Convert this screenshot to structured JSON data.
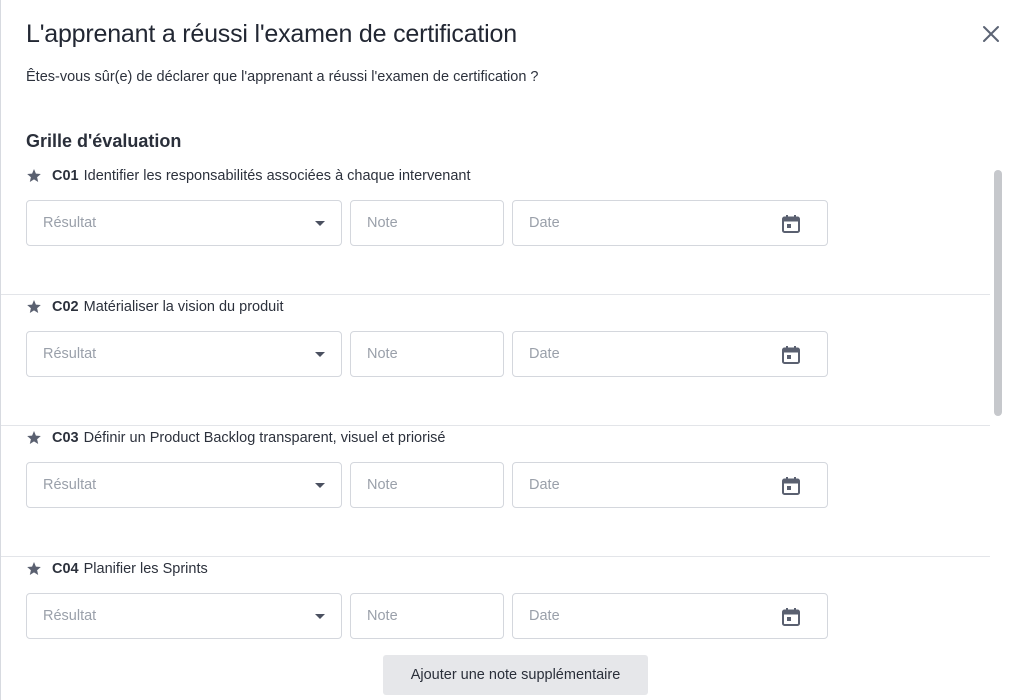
{
  "dialog": {
    "title": "L'apprenant a réussi l'examen de certification",
    "subtitle": "Êtes-vous sûr(e) de déclarer que l'apprenant a réussi l'examen de certification ?",
    "close_icon": "close-icon"
  },
  "grid": {
    "title": "Grille d'évaluation",
    "competencies": [
      {
        "code": "C01",
        "label": "Identifier les responsabilités associées à chaque intervenant",
        "result_placeholder": "Résultat",
        "note_placeholder": "Note",
        "date_placeholder": "Date"
      },
      {
        "code": "C02",
        "label": "Matérialiser la vision du produit",
        "result_placeholder": "Résultat",
        "note_placeholder": "Note",
        "date_placeholder": "Date"
      },
      {
        "code": "C03",
        "label": "Définir un Product Backlog transparent, visuel et priorisé",
        "result_placeholder": "Résultat",
        "note_placeholder": "Note",
        "date_placeholder": "Date"
      },
      {
        "code": "C04",
        "label": "Planifier les Sprints",
        "result_placeholder": "Résultat",
        "note_placeholder": "Note",
        "date_placeholder": "Date"
      }
    ]
  },
  "footer": {
    "add_note_label": "Ajouter une note supplémentaire"
  },
  "icons": {
    "star": "star-icon",
    "dropdown": "caret-down-icon",
    "calendar": "calendar-icon"
  },
  "colors": {
    "border": "#d4d7dd",
    "placeholder": "#9aa0aa",
    "button_bg": "#e6e7ea",
    "icon": "#5a6070"
  }
}
